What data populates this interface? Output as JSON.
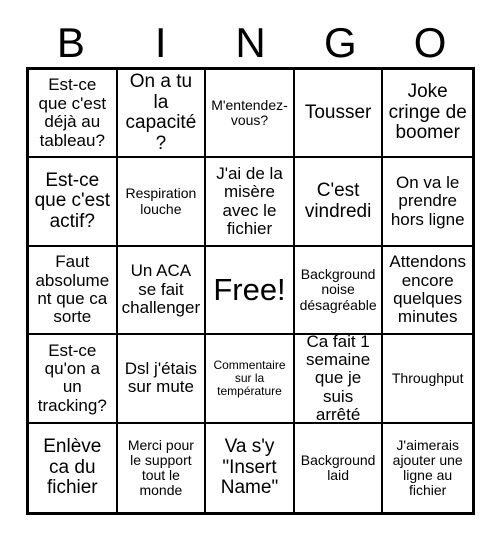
{
  "header": {
    "letters": [
      "B",
      "I",
      "N",
      "G",
      "O"
    ]
  },
  "grid": {
    "columns": 5,
    "rows": 5,
    "cells": [
      {
        "text": "Est-ce que c'est déjà au tableau?",
        "size": "fs-md",
        "free": false
      },
      {
        "text": "On a tu la capacité?",
        "size": "fs-lg",
        "free": false
      },
      {
        "text": "M'entendez-vous?",
        "size": "fs-sm",
        "free": false
      },
      {
        "text": "Tousser",
        "size": "fs-lg",
        "free": false
      },
      {
        "text": "Joke cringe de boomer",
        "size": "fs-lg",
        "free": false
      },
      {
        "text": "Est-ce que c'est actif?",
        "size": "fs-lg",
        "free": false
      },
      {
        "text": "Respiration louche",
        "size": "fs-sm",
        "free": false
      },
      {
        "text": "J'ai de la misère avec le fichier",
        "size": "fs-md",
        "free": false
      },
      {
        "text": "C'est vindredi",
        "size": "fs-lg",
        "free": false
      },
      {
        "text": "On va le prendre hors ligne",
        "size": "fs-md",
        "free": false
      },
      {
        "text": "Faut absolument que ca sorte",
        "size": "fs-md",
        "free": false
      },
      {
        "text": "Un ACA se fait challenger",
        "size": "fs-md",
        "free": false
      },
      {
        "text": "Free!",
        "size": "fs-xl",
        "free": true
      },
      {
        "text": "Background noise désagréable",
        "size": "fs-sm",
        "free": false
      },
      {
        "text": "Attendons encore quelques minutes",
        "size": "fs-md",
        "free": false
      },
      {
        "text": "Est-ce qu'on a un tracking?",
        "size": "fs-md",
        "free": false
      },
      {
        "text": "Dsl j'étais sur mute",
        "size": "fs-md",
        "free": false
      },
      {
        "text": "Commentaire sur la température",
        "size": "fs-xs",
        "free": false
      },
      {
        "text": "Ca fait 1 semaine que je suis arrêté",
        "size": "fs-md",
        "free": false
      },
      {
        "text": "Throughput",
        "size": "fs-sm",
        "free": false
      },
      {
        "text": "Enlève ca du fichier",
        "size": "fs-lg",
        "free": false
      },
      {
        "text": "Merci pour le support tout le monde",
        "size": "fs-sm",
        "free": false
      },
      {
        "text": "Va s'y \"Insert Name\"",
        "size": "fs-lg",
        "free": false
      },
      {
        "text": "Background laid",
        "size": "fs-sm",
        "free": false
      },
      {
        "text": "J'aimerais ajouter une ligne au fichier",
        "size": "fs-sm",
        "free": false
      }
    ]
  },
  "colors": {
    "background": "#ffffff",
    "ink": "#000000",
    "border": "#000000"
  }
}
